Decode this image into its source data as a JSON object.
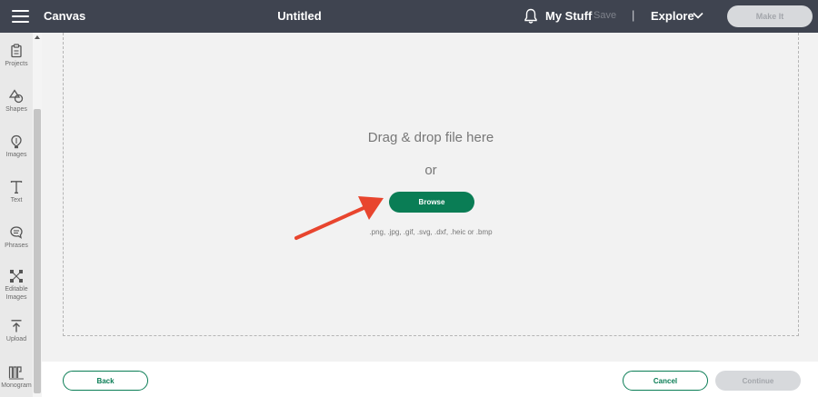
{
  "header": {
    "app_title": "Canvas",
    "doc_title": "Untitled",
    "my_stuff": "My Stuff",
    "save": "Save",
    "divider": "|",
    "explore": "Explore",
    "make_it": "Make It"
  },
  "sidebar": {
    "items": [
      {
        "label": "Projects",
        "icon": "projects-icon"
      },
      {
        "label": "Shapes",
        "icon": "shapes-icon"
      },
      {
        "label": "Images",
        "icon": "images-icon"
      },
      {
        "label": "Text",
        "icon": "text-icon"
      },
      {
        "label": "Phrases",
        "icon": "phrases-icon"
      },
      {
        "label": "Editable Images",
        "icon": "editable-images-icon"
      },
      {
        "label": "Upload",
        "icon": "upload-icon"
      },
      {
        "label": "Monogram",
        "icon": "monogram-icon"
      }
    ]
  },
  "upload": {
    "drag_text": "Drag & drop file here",
    "or_text": "or",
    "browse": "Browse",
    "formats": ".png, .jpg, .gif, .svg, .dxf, .heic or .bmp"
  },
  "footer": {
    "back": "Back",
    "cancel": "Cancel",
    "continue": "Continue"
  },
  "colors": {
    "topbar": "#3f4450",
    "accent": "#0a7d55",
    "arrow": "#e8452e"
  }
}
